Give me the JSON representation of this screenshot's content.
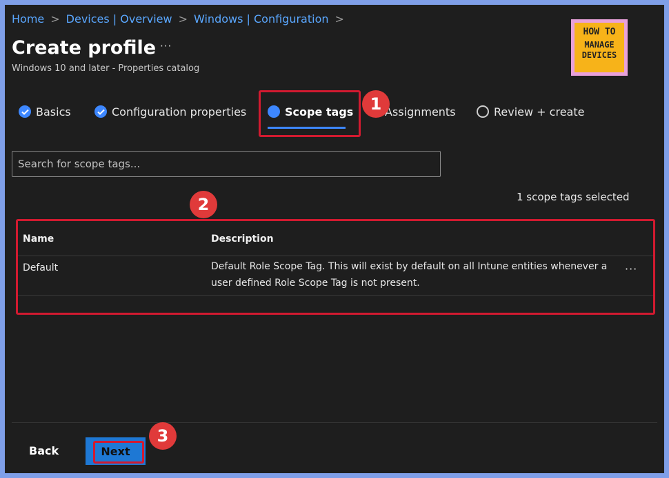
{
  "breadcrumb": [
    "Home",
    "Devices | Overview",
    "Windows | Configuration"
  ],
  "page": {
    "title": "Create profile",
    "more": "···",
    "subtitle": "Windows 10 and later - Properties catalog"
  },
  "logo": {
    "line1": "HOW TO",
    "line2": "MANAGE",
    "line3": "DEVICES"
  },
  "tabs": [
    {
      "label": "Basics",
      "state": "done"
    },
    {
      "label": "Configuration properties",
      "state": "done"
    },
    {
      "label": "Scope tags",
      "state": "active"
    },
    {
      "label": "Assignments",
      "state": "pending"
    },
    {
      "label": "Review + create",
      "state": "pending"
    }
  ],
  "search": {
    "placeholder": "Search for scope tags..."
  },
  "selection_count": "1 scope tags selected",
  "table": {
    "headers": [
      "Name",
      "Description"
    ],
    "rows": [
      {
        "name": "Default",
        "description": "Default Role Scope Tag. This will exist by default on all Intune entities whenever a user defined Role Scope Tag is not present.",
        "more": "···"
      }
    ]
  },
  "annotations": [
    "1",
    "2",
    "3"
  ],
  "footer": {
    "back_label": "Back",
    "next_label": "Next"
  },
  "colors": {
    "accent": "#3d87ff",
    "highlight": "#d21a30",
    "badge": "#e03a3a",
    "frame": "#7f9fe8"
  }
}
